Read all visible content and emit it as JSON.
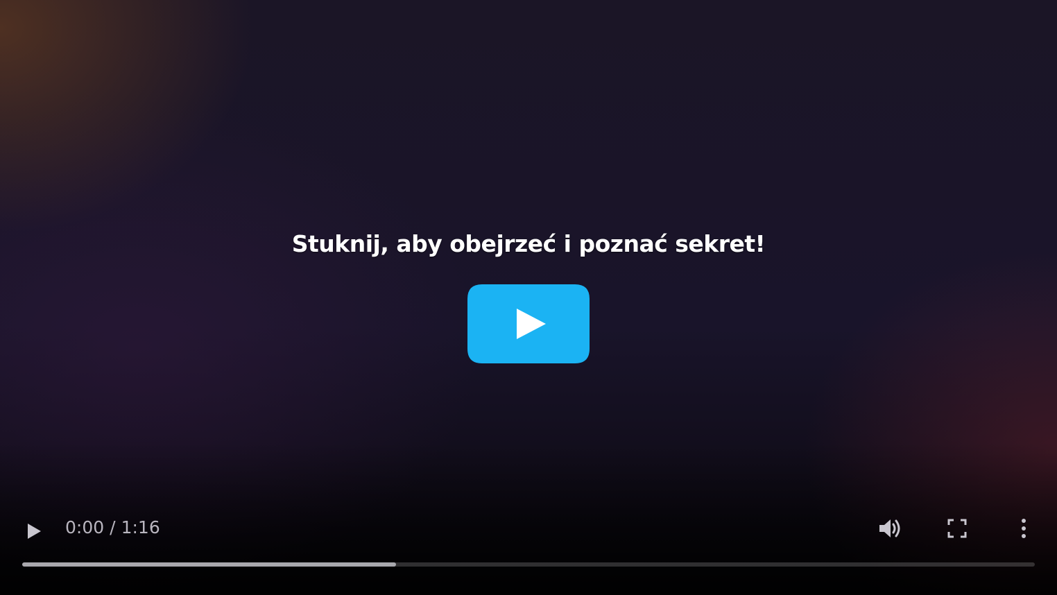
{
  "video": {
    "overlay_text": "Stuknij, aby obejrzeć i poznać sekret!",
    "big_play_icon": "play-icon",
    "big_play_color": "#1bb3f3"
  },
  "controls": {
    "play_icon": "play-icon",
    "current_time": "0:00",
    "separator": "/",
    "duration": "1:16",
    "volume_icon": "volume-icon",
    "fullscreen_icon": "fullscreen-icon",
    "more_icon": "more-options-icon",
    "buffered_fraction": 0.369
  }
}
